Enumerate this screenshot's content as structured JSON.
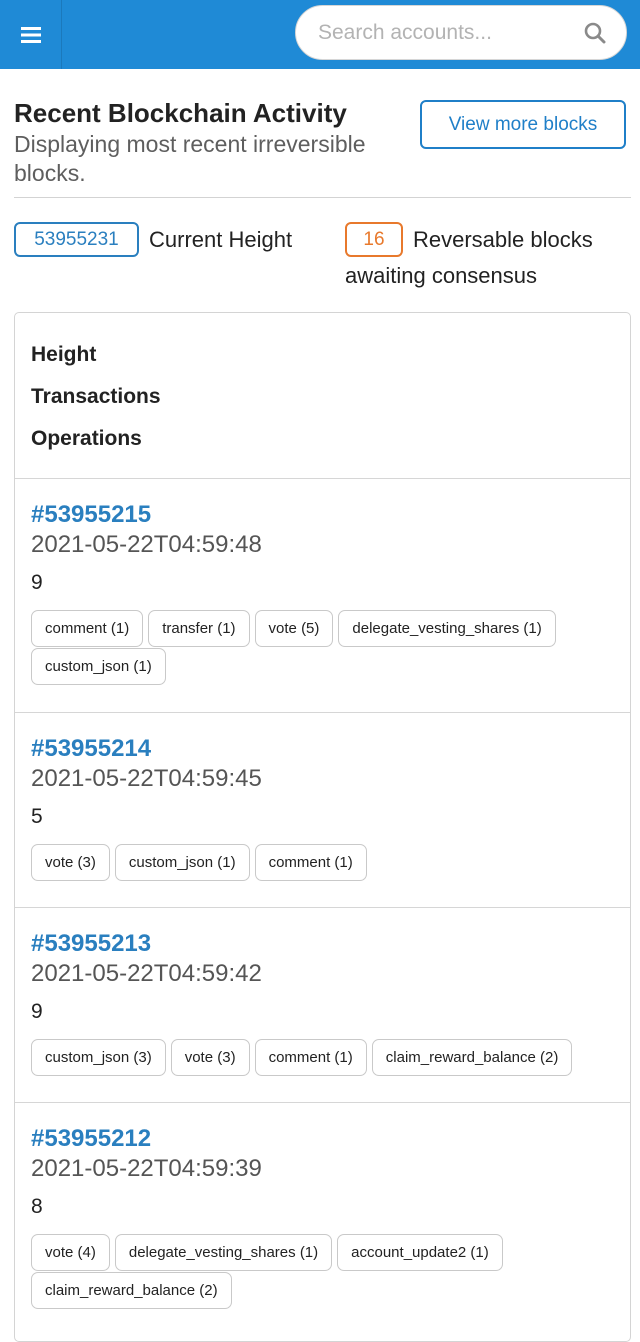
{
  "search": {
    "placeholder": "Search accounts..."
  },
  "header": {
    "title": "Recent Blockchain Activity",
    "subtitle": "Displaying most recent irreversible blocks.",
    "view_more_label": "View more blocks"
  },
  "stats": {
    "current_height": {
      "value": "53955231",
      "label": "Current Height"
    },
    "reversible": {
      "value": "16",
      "label": "Reversable blocks awaiting consensus"
    }
  },
  "table": {
    "columns": [
      "Height",
      "Transactions",
      "Operations"
    ],
    "rows": [
      {
        "block": "#53955215",
        "time": "2021-05-22T04:59:48",
        "transactions": "9",
        "ops": [
          "comment (1)",
          "transfer (1)",
          "vote (5)",
          "delegate_vesting_shares (1)",
          "custom_json (1)"
        ]
      },
      {
        "block": "#53955214",
        "time": "2021-05-22T04:59:45",
        "transactions": "5",
        "ops": [
          "vote (3)",
          "custom_json (1)",
          "comment (1)"
        ]
      },
      {
        "block": "#53955213",
        "time": "2021-05-22T04:59:42",
        "transactions": "9",
        "ops": [
          "custom_json (3)",
          "vote (3)",
          "comment (1)",
          "claim_reward_balance (2)"
        ]
      },
      {
        "block": "#53955212",
        "time": "2021-05-22T04:59:39",
        "transactions": "8",
        "ops": [
          "vote (4)",
          "delegate_vesting_shares (1)",
          "account_update2 (1)",
          "claim_reward_balance (2)"
        ]
      }
    ]
  },
  "colors": {
    "topbar": "#1f8ad6",
    "link": "#2a7fbf",
    "accent_orange": "#e8792c"
  },
  "icons": {
    "menu": "hamburger-menu-icon",
    "search": "search-icon"
  }
}
